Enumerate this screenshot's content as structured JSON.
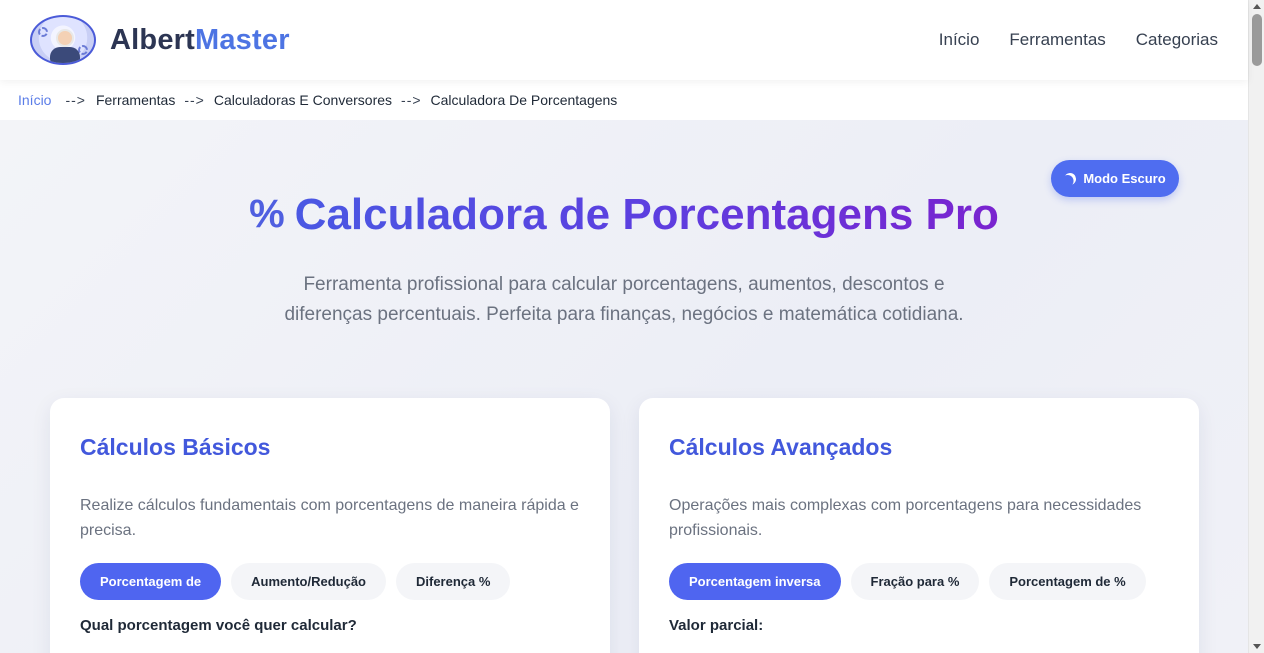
{
  "brand": {
    "name_part1": "Albert",
    "name_part2": "Master"
  },
  "nav": {
    "items": [
      {
        "label": "Início"
      },
      {
        "label": "Ferramentas"
      },
      {
        "label": "Categorias"
      }
    ]
  },
  "breadcrumb": {
    "items": [
      {
        "label": "Início"
      },
      {
        "label": "Ferramentas"
      },
      {
        "label": "Calculadoras E Conversores"
      },
      {
        "label": "Calculadora De Porcentagens"
      }
    ],
    "separator": "-->"
  },
  "dark_mode_button": {
    "label": "Modo Escuro",
    "icon": "moon-icon"
  },
  "hero": {
    "icon_glyph": "%",
    "title": "Calculadora de Porcentagens Pro",
    "subtitle": "Ferramenta profissional para calcular porcentagens, aumentos, descontos e diferenças percentuais. Perfeita para finanças, negócios e matemática cotidiana."
  },
  "cards": [
    {
      "title": "Cálculos Básicos",
      "description": "Realize cálculos fundamentais com porcentagens de maneira rápida e precisa.",
      "tabs": [
        {
          "label": "Porcentagem de",
          "active": true
        },
        {
          "label": "Aumento/Redução",
          "active": false
        },
        {
          "label": "Diferença %",
          "active": false
        }
      ],
      "field_label": "Qual porcentagem você quer calcular?"
    },
    {
      "title": "Cálculos Avançados",
      "description": "Operações mais complexas com porcentagens para necessidades profissionais.",
      "tabs": [
        {
          "label": "Porcentagem inversa",
          "active": true
        },
        {
          "label": "Fração para %",
          "active": false
        },
        {
          "label": "Porcentagem de %",
          "active": false
        }
      ],
      "field_label": "Valor parcial:"
    }
  ],
  "colors": {
    "accent": "#4f65f0",
    "brand_dark": "#2c3553",
    "brand_light": "#4d74e3",
    "title_gradient_end": "#7a23cf"
  }
}
